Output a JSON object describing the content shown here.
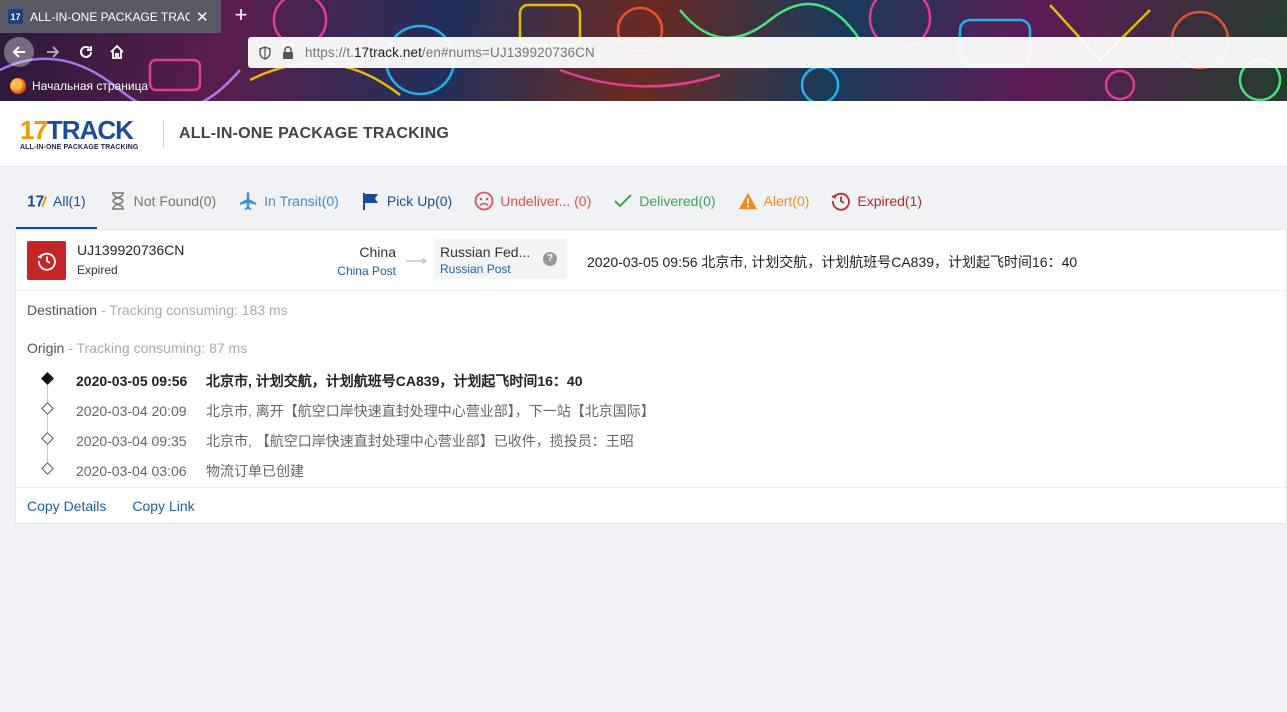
{
  "browser": {
    "tab_title": "ALL-IN-ONE PACKAGE TRACK",
    "tab_favicon": "17",
    "new_tab": "+",
    "url_prefix": "https://t.",
    "url_domain": "17track.net",
    "url_suffix": "/en#nums=UJ139920736CN",
    "bookmark": "Начальная страница"
  },
  "header": {
    "logo_num": "17",
    "logo_word": "TRACK",
    "logo_sub": "ALL-IN-ONE PACKAGE TRACKING",
    "title": "ALL-IN-ONE PACKAGE TRACKING"
  },
  "filters": [
    {
      "label": "All(1)",
      "icon": "17-logo-icon",
      "color": "#1c4b9c"
    },
    {
      "label": "Not Found(0)",
      "icon": "hourglass-icon",
      "color": "#777777"
    },
    {
      "label": "In Transit(0)",
      "icon": "airplane-icon",
      "color": "#3d8fd6"
    },
    {
      "label": "Pick Up(0)",
      "icon": "flag-icon",
      "color": "#1c4b9c"
    },
    {
      "label": "Undeliver... (0)",
      "icon": "sad-face-icon",
      "color": "#e05050"
    },
    {
      "label": "Delivered(0)",
      "icon": "checkmark-icon",
      "color": "#3aa655"
    },
    {
      "label": "Alert(0)",
      "icon": "warning-icon",
      "color": "#f28a1c"
    },
    {
      "label": "Expired(1)",
      "icon": "history-icon",
      "color": "#b72a2a"
    }
  ],
  "shipment": {
    "tracking_number": "UJ139920736CN",
    "status": "Expired",
    "status_color": "#c42526",
    "origin_country": "China",
    "origin_carrier": "China Post",
    "dest_country": "Russian Fed...",
    "dest_carrier": "Russian Post",
    "help": "?",
    "latest_event": "2020-03-05 09:56  北京市, 计划交航，计划航班号CA839，计划起飞时间16：40"
  },
  "destination_section": {
    "label": "Destination",
    "consuming": " - Tracking consuming: 183 ms"
  },
  "origin_section": {
    "label": "Origin",
    "consuming": " - Tracking consuming: 87 ms"
  },
  "events": [
    {
      "datetime": "2020-03-05 09:56",
      "description": "北京市, 计划交航，计划航班号CA839，计划起飞时间16：40"
    },
    {
      "datetime": "2020-03-04 20:09",
      "description": "北京市, 离开【航空口岸快速直封处理中心营业部】，下一站【北京国际】"
    },
    {
      "datetime": "2020-03-04 09:35",
      "description": "北京市, 【航空口岸快速直封处理中心营业部】已收件，揽投员：王昭"
    },
    {
      "datetime": "2020-03-04 03:06",
      "description": "物流订单已创建"
    }
  ],
  "actions": {
    "copy_details": "Copy Details",
    "copy_link": "Copy Link"
  }
}
